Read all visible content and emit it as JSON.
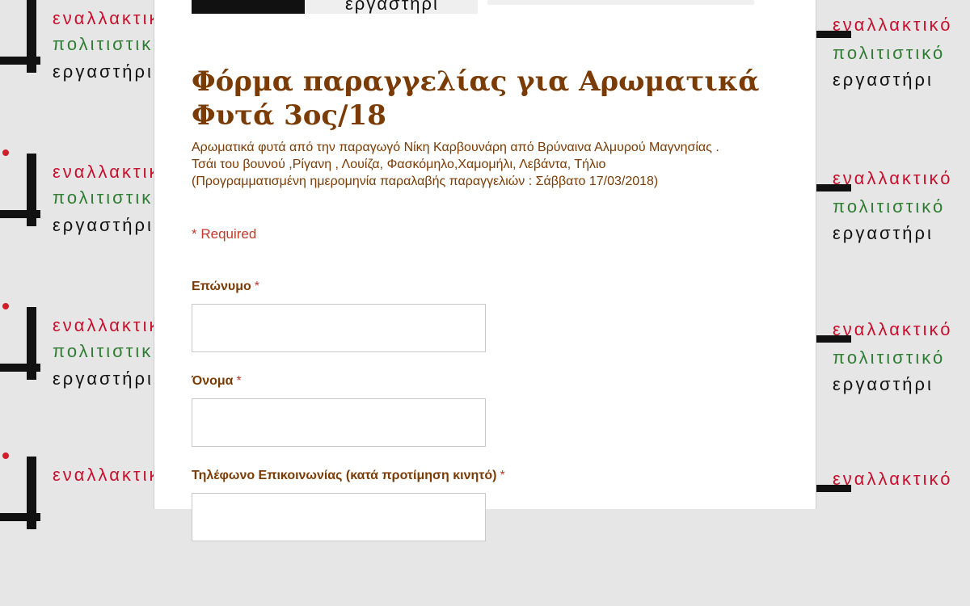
{
  "background": {
    "tile_line1": "εναλλακτικό",
    "tile_line2": "πολιτιστικό",
    "tile_line3": "εργαστήρι"
  },
  "header": {
    "logo_text": "εργαστήρι"
  },
  "form": {
    "title": "Φόρμα παραγγελίας για Αρωματικά Φυτά 3ος/18",
    "description": "Αρωματικά φυτά από την παραγωγό Νίκη Καρβουνάρη από Βρύναινα Αλμυρού Μαγνησίας .\nΤσάι του βουνού ,Ρίγανη , Λουίζα, Φασκόμηλο,Χαμομήλι, Λεβάντα, Τήλιο\n(Προγραμματισμένη ημερομηνία παραλαβής παραγγελιών : Σάββατο 17/03/2018)",
    "required_note": "* Required",
    "questions": [
      {
        "label": "Επώνυμο",
        "required_mark": "*",
        "value": ""
      },
      {
        "label": "Όνομα",
        "required_mark": "*",
        "value": ""
      },
      {
        "label": "Τηλέφωνο Επικοινωνίας (κατά προτίμηση κινητό)",
        "required_mark": "*",
        "value": ""
      }
    ]
  },
  "colors": {
    "title": "#7a3b04",
    "required": "#c0392b",
    "tile_red": "#c8102e",
    "tile_green": "#2e7d32"
  }
}
